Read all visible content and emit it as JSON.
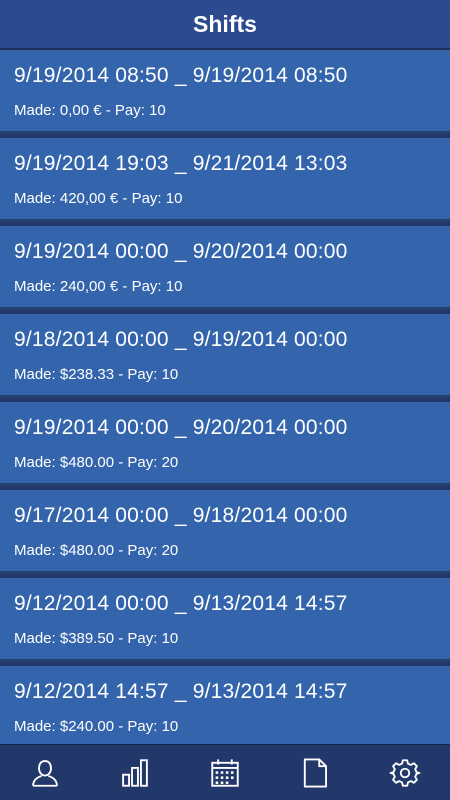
{
  "header": {
    "title": "Shifts"
  },
  "shifts": [
    {
      "dates": "9/19/2014 08:50 _ 9/19/2014 08:50",
      "meta": "Made: 0,00 € - Pay: 10"
    },
    {
      "dates": "9/19/2014 19:03 _ 9/21/2014 13:03",
      "meta": "Made: 420,00 € - Pay: 10"
    },
    {
      "dates": "9/19/2014 00:00 _ 9/20/2014 00:00",
      "meta": "Made: 240,00 € - Pay: 10"
    },
    {
      "dates": "9/18/2014 00:00 _ 9/19/2014 00:00",
      "meta": "Made: $238.33 - Pay: 10"
    },
    {
      "dates": "9/19/2014 00:00 _ 9/20/2014 00:00",
      "meta": "Made: $480.00 - Pay: 20"
    },
    {
      "dates": "9/17/2014 00:00 _ 9/18/2014 00:00",
      "meta": "Made: $480.00 - Pay: 20"
    },
    {
      "dates": "9/12/2014 00:00 _ 9/13/2014 14:57",
      "meta": "Made: $389.50 - Pay: 10"
    },
    {
      "dates": "9/12/2014 14:57 _ 9/13/2014 14:57",
      "meta": "Made: $240.00 - Pay: 10"
    }
  ],
  "bottom_nav": [
    {
      "icon": "user-icon"
    },
    {
      "icon": "bar-chart-icon"
    },
    {
      "icon": "calendar-icon"
    },
    {
      "icon": "document-icon"
    },
    {
      "icon": "gear-icon"
    }
  ],
  "colors": {
    "header_bg": "#2b4a8f",
    "row_bg": "#3465ac",
    "divider": "#24406f",
    "bottom_bar_bg": "#23386a",
    "text": "#ffffff"
  }
}
